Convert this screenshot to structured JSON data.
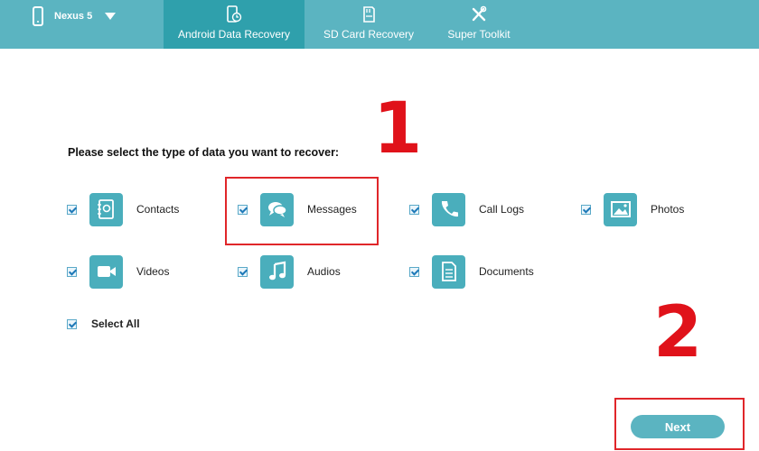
{
  "device": {
    "name": "Nexus 5",
    "icon": "phone-icon"
  },
  "tabs": [
    {
      "label": "Android Data Recovery",
      "icon": "phone-recovery-icon",
      "active": true
    },
    {
      "label": "SD Card Recovery",
      "icon": "sd-card-icon",
      "active": false
    },
    {
      "label": "Super Toolkit",
      "icon": "tools-icon",
      "active": false
    }
  ],
  "prompt": "Please select the type of data you want to recover:",
  "options": [
    {
      "label": "Contacts",
      "icon": "contacts-icon",
      "checked": true
    },
    {
      "label": "Messages",
      "icon": "messages-icon",
      "checked": true
    },
    {
      "label": "Call Logs",
      "icon": "phone-icon",
      "checked": true
    },
    {
      "label": "Photos",
      "icon": "photos-icon",
      "checked": true
    },
    {
      "label": "Videos",
      "icon": "video-camera-icon",
      "checked": true
    },
    {
      "label": "Audios",
      "icon": "music-note-icon",
      "checked": true
    },
    {
      "label": "Documents",
      "icon": "document-icon",
      "checked": true
    }
  ],
  "select_all": {
    "label": "Select All",
    "checked": true
  },
  "next_label": "Next",
  "annotations": {
    "step1": "1",
    "step2": "2"
  },
  "colors": {
    "accent": "#5bb4c1",
    "tab_active": "#2fa0ac",
    "tile": "#4aaebc",
    "annotation": "#e0262a"
  }
}
